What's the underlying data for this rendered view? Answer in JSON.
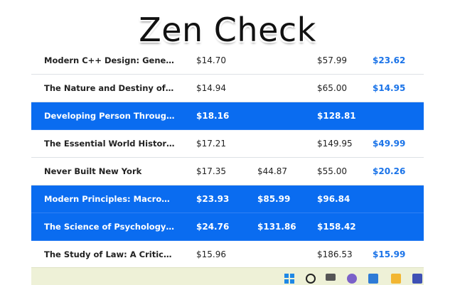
{
  "app_title": "Zen Check",
  "table": {
    "rows": [
      {
        "title": "Modern C++ Design: Generic Pro...",
        "price_1": "$14.70",
        "price_2": "",
        "price_3": "$57.99",
        "price_4": "$23.62",
        "highlighted": false
      },
      {
        "title": "The Nature and Destiny of Man: ...",
        "price_1": "$14.94",
        "price_2": "",
        "price_3": "$65.00",
        "price_4": "$14.95",
        "highlighted": false
      },
      {
        "title": "Developing Person Through Chil...",
        "price_1": "$18.16",
        "price_2": "",
        "price_3": "$128.81",
        "price_4": "",
        "highlighted": true
      },
      {
        "title": "The Essential World History, Vol...",
        "price_1": "$17.21",
        "price_2": "",
        "price_3": "$149.95",
        "price_4": "$49.99",
        "highlighted": false
      },
      {
        "title": "Never Built New York",
        "price_1": "$17.35",
        "price_2": "$44.87",
        "price_3": "$55.00",
        "price_4": "$20.26",
        "highlighted": false
      },
      {
        "title": "Modern Principles: Macroecono...",
        "price_1": "$23.93",
        "price_2": "$85.99",
        "price_3": "$96.84",
        "price_4": "",
        "highlighted": true
      },
      {
        "title": "The Science of Psychology: An A...",
        "price_1": "$24.76",
        "price_2": "$131.86",
        "price_3": "$158.42",
        "price_4": "",
        "highlighted": true
      },
      {
        "title": "The Study of Law: A Critical Thi...",
        "price_1": "$15.96",
        "price_2": "",
        "price_3": "$186.53",
        "price_4": "$15.99",
        "highlighted": false
      }
    ]
  },
  "taskbar": {
    "icons": [
      "windows-start-icon",
      "search-icon",
      "task-view-icon",
      "app-icon",
      "app-icon",
      "folder-icon",
      "app-icon"
    ]
  },
  "colors": {
    "highlight_row": "#0a6cf0",
    "best_price_text": "#1a73e8",
    "taskbar_background": "#eef1d7"
  }
}
